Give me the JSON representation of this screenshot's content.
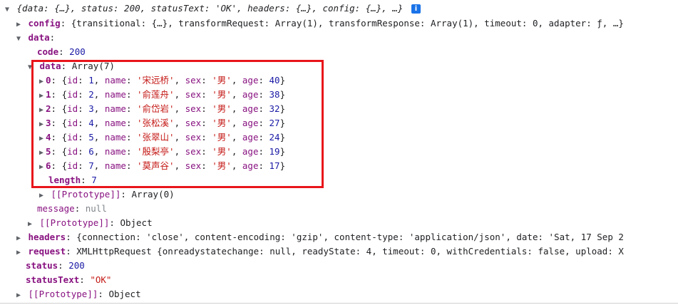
{
  "summary": "{data: {…}, status: 200, statusText: 'OK', headers: {…}, config: {…}, …}",
  "info_icon": "info-icon",
  "config": {
    "key": "config",
    "value": "{transitional: {…}, transformRequest: Array(1), transformResponse: Array(1), timeout: 0, adapter: ƒ, …}"
  },
  "data": {
    "key": "data",
    "code": {
      "key": "code",
      "value": "200"
    },
    "array": {
      "key": "data",
      "value": "Array(7)",
      "items": [
        {
          "index": "0",
          "id": "1",
          "name": "'宋远桥'",
          "sex": "'男'",
          "age": "40"
        },
        {
          "index": "1",
          "id": "2",
          "name": "'俞莲舟'",
          "sex": "'男'",
          "age": "38"
        },
        {
          "index": "2",
          "id": "3",
          "name": "'俞岱岩'",
          "sex": "'男'",
          "age": "32"
        },
        {
          "index": "3",
          "id": "4",
          "name": "'张松溪'",
          "sex": "'男'",
          "age": "27"
        },
        {
          "index": "4",
          "id": "5",
          "name": "'张翠山'",
          "sex": "'男'",
          "age": "24"
        },
        {
          "index": "5",
          "id": "6",
          "name": "'殷梨亭'",
          "sex": "'男'",
          "age": "19"
        },
        {
          "index": "6",
          "id": "7",
          "name": "'莫声谷'",
          "sex": "'男'",
          "age": "17"
        }
      ],
      "length_key": "length",
      "length_value": "7",
      "prototype_key": "[[Prototype]]",
      "prototype_value": "Array(0)"
    },
    "message": {
      "key": "message",
      "value": "null"
    },
    "prototype": {
      "key": "[[Prototype]]",
      "value": "Object"
    }
  },
  "headers": {
    "key": "headers",
    "value": "{connection: 'close', content-encoding: 'gzip', content-type: 'application/json', date: 'Sat, 17 Sep 2"
  },
  "request": {
    "key": "request",
    "value": "XMLHttpRequest {onreadystatechange: null, readyState: 4, timeout: 0, withCredentials: false, upload: X"
  },
  "status": {
    "key": "status",
    "value": "200"
  },
  "statusText": {
    "key": "statusText",
    "value": "\"OK\""
  },
  "root_prototype": {
    "key": "[[Prototype]]",
    "value": "Object"
  },
  "colors": {
    "highlight_border": "#e8151b",
    "key_color": "#881280",
    "number_color": "#1a1aa6",
    "string_color": "#c41a16"
  },
  "prop_labels": {
    "id": "id",
    "name": "name",
    "sex": "sex",
    "age": "age"
  }
}
